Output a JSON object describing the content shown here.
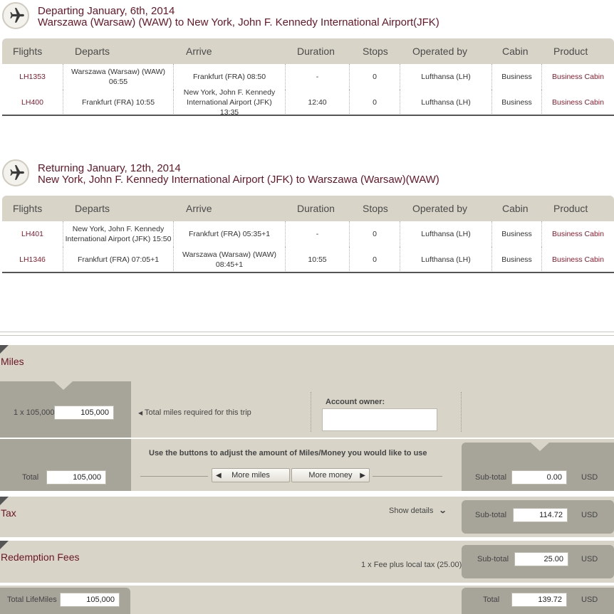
{
  "outbound": {
    "title_line1": "Departing January, 6th, 2014",
    "title_line2": "Warszawa (Warsaw) (WAW) to New York, John F. Kennedy International Airport(JFK)"
  },
  "inbound": {
    "title_line1": "Returning January, 12th, 2014",
    "title_line2": "New York, John F. Kennedy International Airport (JFK) to Warszawa (Warsaw)(WAW)"
  },
  "columns": [
    "Flights",
    "Departs",
    "Arrive",
    "Duration",
    "Stops",
    "Operated by",
    "Cabin",
    "Product"
  ],
  "outbound_rows": [
    {
      "flight": "LH1353",
      "departs": "Warszawa (Warsaw) (WAW) 06:55",
      "arrive": "Frankfurt (FRA) 08:50",
      "duration": "-",
      "stops": "0",
      "operated": "Lufthansa (LH)",
      "cabin": "Business",
      "product": "Business Cabin"
    },
    {
      "flight": "LH400",
      "departs": "Frankfurt (FRA) 10:55",
      "arrive": "New York, John F. Kennedy International Airport (JFK) 13:35",
      "duration": "12:40",
      "stops": "0",
      "operated": "Lufthansa (LH)",
      "cabin": "Business",
      "product": "Business Cabin"
    }
  ],
  "inbound_rows": [
    {
      "flight": "LH401",
      "departs": "New York, John F. Kennedy International Airport (JFK) 15:50",
      "arrive": "Frankfurt (FRA) 05:35+1",
      "duration": "-",
      "stops": "0",
      "operated": "Lufthansa (LH)",
      "cabin": "Business",
      "product": "Business Cabin"
    },
    {
      "flight": "LH1346",
      "departs": "Frankfurt (FRA) 07:05+1",
      "arrive": "Warszawa (Warsaw) (WAW) 08:45+1",
      "duration": "10:55",
      "stops": "0",
      "operated": "Lufthansa (LH)",
      "cabin": "Business",
      "product": "Business Cabin"
    }
  ],
  "miles": {
    "label": "Miles",
    "multiplier": "1 x 105,000",
    "per_trip_value": "105,000",
    "required_note": "Total miles required for this trip",
    "account_owner_label": "Account owner:",
    "account_owner_value": "",
    "total_label": "Total",
    "total_value": "105,000",
    "adjust_text": "Use the buttons to adjust the amount of Miles/Money you would like to use",
    "more_miles": "More miles",
    "more_money": "More money",
    "subtotal_label": "Sub-total",
    "subtotal_value": "0.00",
    "currency": "USD"
  },
  "tax": {
    "label": "Tax",
    "show_details": "Show details",
    "subtotal_label": "Sub-total",
    "subtotal_value": "114.72",
    "currency": "USD"
  },
  "fees": {
    "label": "Redemption Fees",
    "note": "1 x Fee plus local tax (25.00)",
    "subtotal_label": "Sub-total",
    "subtotal_value": "25.00",
    "currency": "USD"
  },
  "summary": {
    "total_lifemiles_label": "Total LifeMiles",
    "total_lifemiles_value": "105,000",
    "total_label": "Total",
    "total_value": "139.72",
    "currency": "USD"
  }
}
